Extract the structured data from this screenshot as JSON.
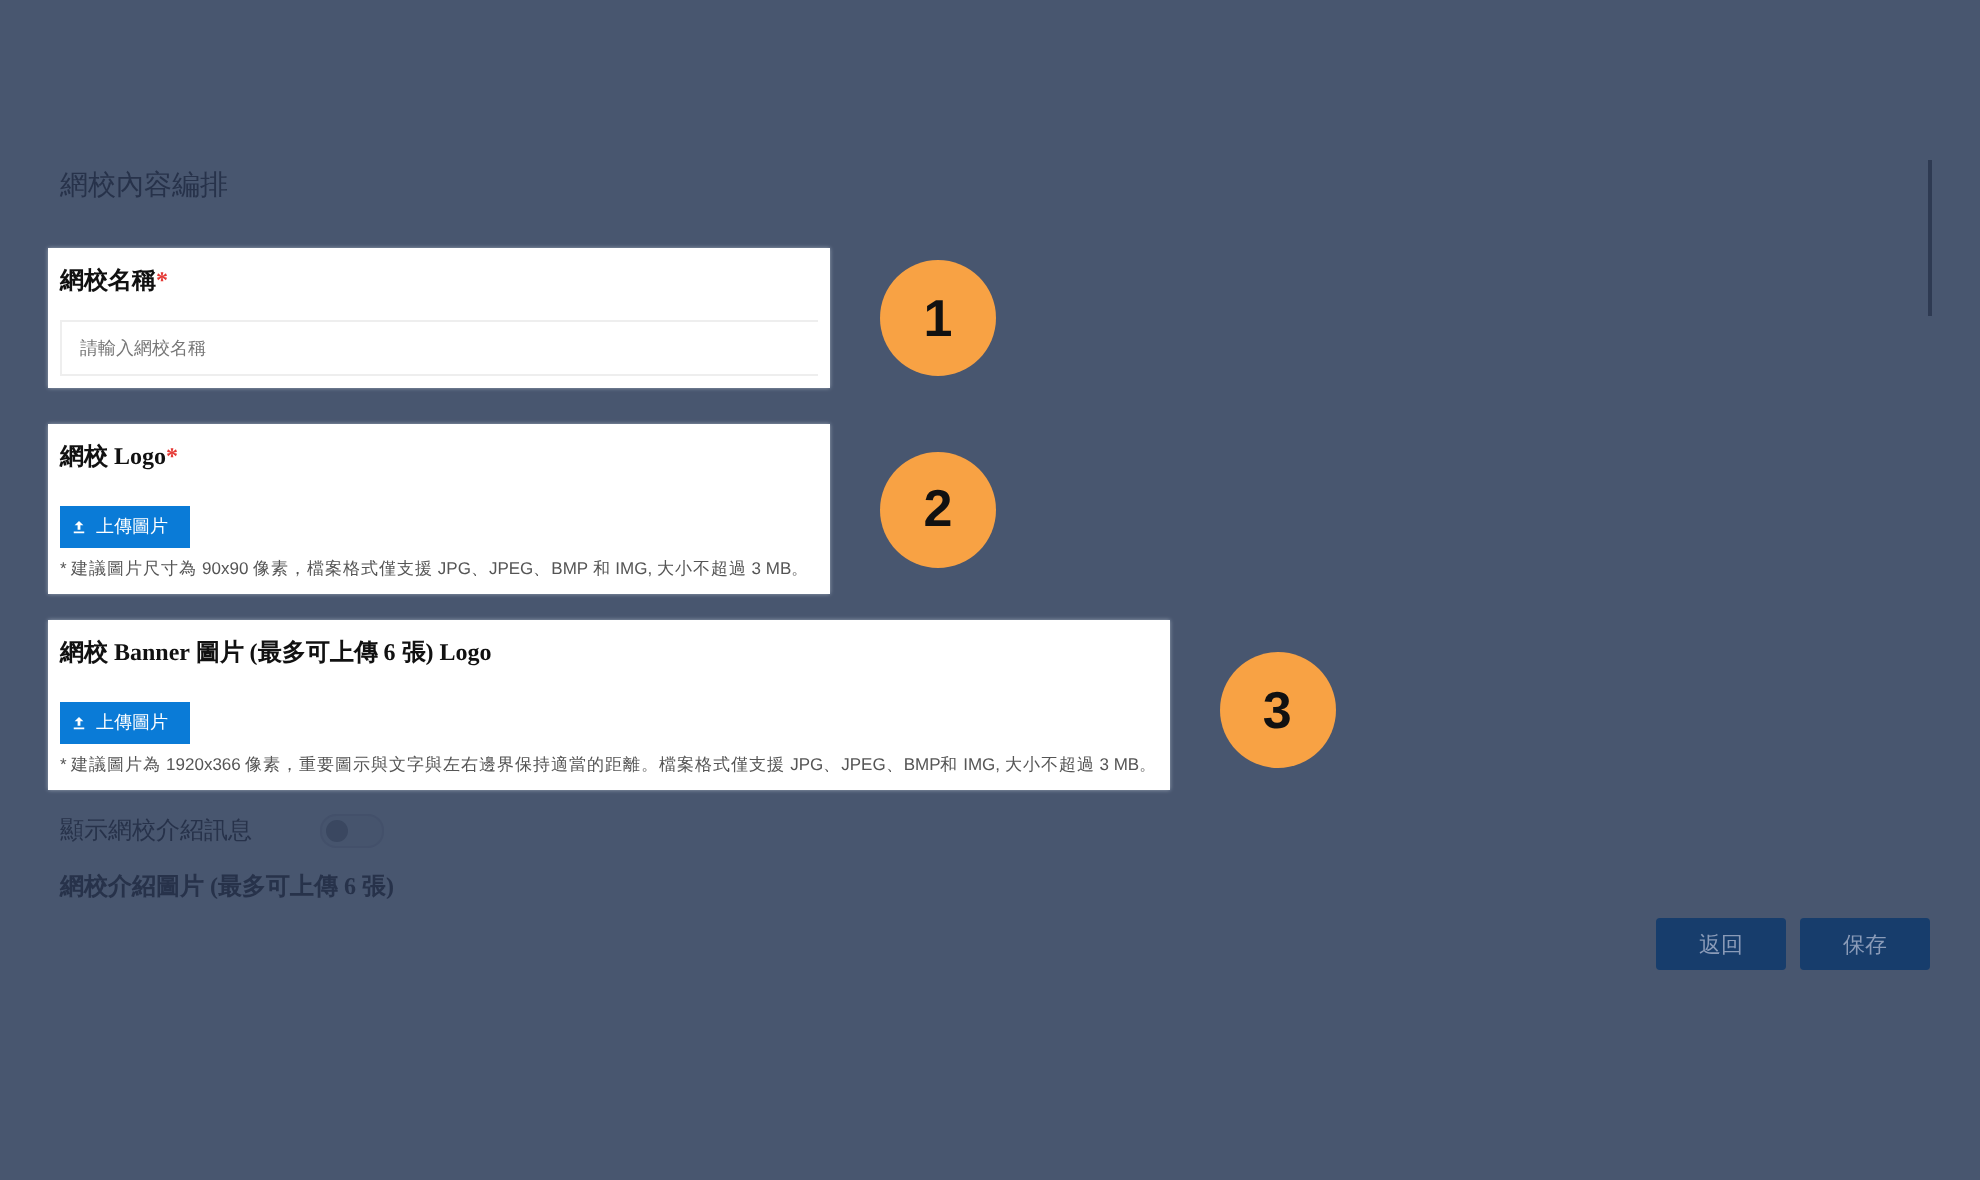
{
  "page": {
    "title": "網校內容編排"
  },
  "sections": [
    {
      "kind": "text",
      "step": "1",
      "title": "網校名稱",
      "required_mark": "*",
      "placeholder": "請輸入網校名稱"
    },
    {
      "kind": "upload",
      "step": "2",
      "title": "網校 Logo",
      "required_mark": "*",
      "button": "上傳圖片",
      "hint": "* 建議圖片尺寸為 90x90 像素，檔案格式僅支援 JPG、JPEG、BMP 和 IMG, 大小不超過 3 MB。"
    },
    {
      "kind": "upload",
      "step": "3",
      "title": "網校 Banner 圖片 (最多可上傳 6 張) Logo",
      "button": "上傳圖片",
      "hint": "* 建議圖片為 1920x366 像素，重要圖示與文字與左右邊界保持適當的距離。檔案格式僅支援 JPG、JPEG、BMP和 IMG, 大小不超過 3 MB。"
    }
  ],
  "intro_toggle": {
    "label": "顯示網校介紹訊息",
    "on": false
  },
  "intro_images": {
    "title": "網校介紹圖片 (最多可上傳 6 張)"
  },
  "buttons": [
    "返回",
    "保存"
  ]
}
